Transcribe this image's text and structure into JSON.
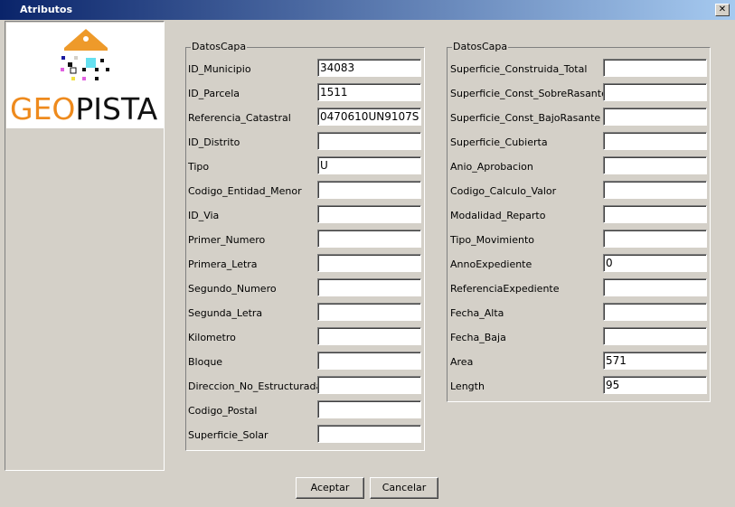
{
  "window": {
    "title": "Atributos",
    "close_glyph": "✕"
  },
  "logo": {
    "word_geo": "GEO",
    "word_pista": "PISTA"
  },
  "left_group": {
    "legend": "DatosCapa",
    "rows": [
      {
        "label": "ID_Municipio",
        "value": "34083"
      },
      {
        "label": "ID_Parcela",
        "value": "1511"
      },
      {
        "label": "Referencia_Catastral",
        "value": "0470610UN9107S"
      },
      {
        "label": "ID_Distrito",
        "value": ""
      },
      {
        "label": "Tipo",
        "value": "U"
      },
      {
        "label": "Codigo_Entidad_Menor",
        "value": ""
      },
      {
        "label": "ID_Via",
        "value": ""
      },
      {
        "label": "Primer_Numero",
        "value": ""
      },
      {
        "label": "Primera_Letra",
        "value": ""
      },
      {
        "label": "Segundo_Numero",
        "value": ""
      },
      {
        "label": "Segunda_Letra",
        "value": ""
      },
      {
        "label": "Kilometro",
        "value": ""
      },
      {
        "label": "Bloque",
        "value": ""
      },
      {
        "label": "Direccion_No_Estructurada",
        "value": ""
      },
      {
        "label": "Codigo_Postal",
        "value": ""
      },
      {
        "label": "Superficie_Solar",
        "value": ""
      }
    ]
  },
  "right_group": {
    "legend": "DatosCapa",
    "rows": [
      {
        "label": "Superficie_Construida_Total",
        "value": ""
      },
      {
        "label": "Superficie_Const_SobreRasante",
        "value": ""
      },
      {
        "label": "Superficie_Const_BajoRasante",
        "value": ""
      },
      {
        "label": "Superficie_Cubierta",
        "value": ""
      },
      {
        "label": "Anio_Aprobacion",
        "value": ""
      },
      {
        "label": "Codigo_Calculo_Valor",
        "value": ""
      },
      {
        "label": "Modalidad_Reparto",
        "value": ""
      },
      {
        "label": "Tipo_Movimiento",
        "value": ""
      },
      {
        "label": "AnnoExpediente",
        "value": "0"
      },
      {
        "label": "ReferenciaExpediente",
        "value": ""
      },
      {
        "label": "Fecha_Alta",
        "value": ""
      },
      {
        "label": "Fecha_Baja",
        "value": ""
      },
      {
        "label": "Area",
        "value": "571"
      },
      {
        "label": "Length",
        "value": "95"
      }
    ]
  },
  "buttons": {
    "accept": "Aceptar",
    "cancel": "Cancelar"
  }
}
